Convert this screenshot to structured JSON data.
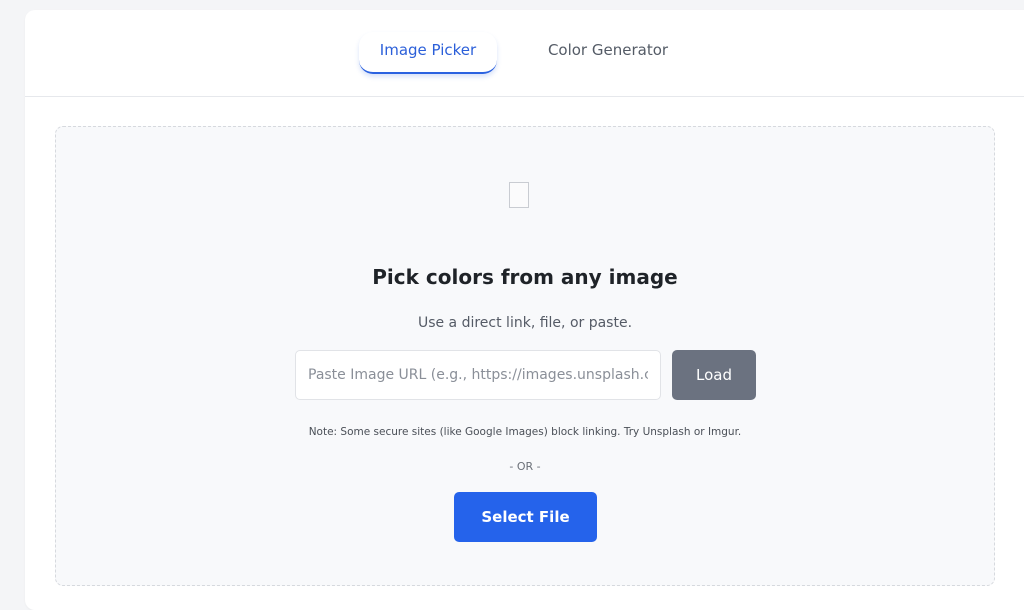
{
  "tabs": {
    "active": "Image Picker",
    "inactive": "Color Generator"
  },
  "upload": {
    "placeholder_icon": "image-placeholder-icon",
    "heading": "Pick colors from any image",
    "subtext": "Use a direct link, file, or paste.",
    "url_placeholder": "Paste Image URL (e.g., https://images.unsplash.com/...)",
    "url_value": "",
    "load_label": "Load",
    "note": "Note: Some secure sites (like Google Images) block linking. Try Unsplash or Imgur.",
    "divider": "- OR -",
    "select_file_label": "Select File"
  },
  "colors": {
    "accent": "#2563eb",
    "load_button": "#6b7280",
    "dropzone_bg": "#f8f9fb"
  }
}
